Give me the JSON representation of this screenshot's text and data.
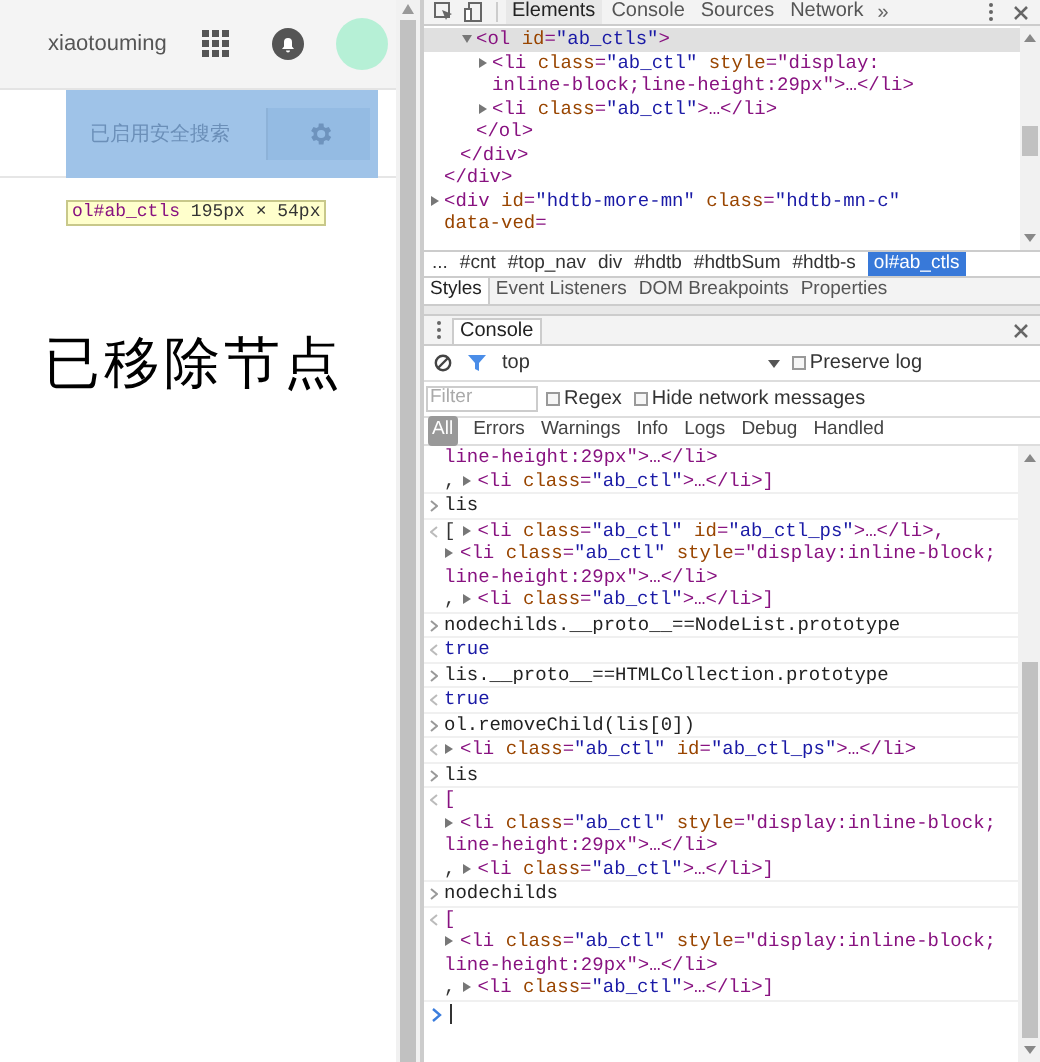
{
  "page": {
    "username": "xiaotouming",
    "safe_search": {
      "label": "已启用安全搜索"
    },
    "tooltip": "ol#ab_ctls 195px × 54px",
    "handwritten_note": "已移除节点"
  },
  "devtools": {
    "tabs": [
      {
        "label": "Elements",
        "selected": true
      },
      {
        "label": "Console",
        "selected": false
      },
      {
        "label": "Sources",
        "selected": false
      },
      {
        "label": "Network",
        "selected": false
      }
    ],
    "more_tabs": "»",
    "elements_tree": [
      {
        "closing": "</div>",
        "children": [
          {
            "closing": "</div>",
            "children": [
              {
                "lines": [
                  "<ol id=\"ab_ctls\">"
                ],
                "expanded": true,
                "selected": true,
                "closing": "</ol>",
                "children": [
                  {
                    "lines": [
                      "<li class=\"ab_ctl\" style=\"display:",
                      "inline-block;line-height:29px\">…</li>"
                    ],
                    "expanded": false,
                    "selected": false
                  },
                  {
                    "lines": [
                      "<li class=\"ab_ctl\">…</li>"
                    ],
                    "expanded": false,
                    "selected": false
                  }
                ]
              }
            ]
          }
        ]
      },
      {
        "lines": [
          "<div id=\"hdtb-more-mn\" class=\"hdtb-mn-c\"",
          "data-ved="
        ],
        "expanded": false,
        "selected": false
      }
    ],
    "breadcrumbs": [
      {
        "label": "...",
        "selected": false
      },
      {
        "label": "#cnt",
        "selected": false
      },
      {
        "label": "#top_nav",
        "selected": false
      },
      {
        "label": "div",
        "selected": false
      },
      {
        "label": "#hdtb",
        "selected": false
      },
      {
        "label": "#hdtbSum",
        "selected": false
      },
      {
        "label": "#hdtb-s",
        "selected": false
      },
      {
        "label": "ol#ab_ctls",
        "selected": true
      }
    ],
    "sidebar_tabs": [
      {
        "label": "Styles",
        "selected": true
      },
      {
        "label": "Event Listeners",
        "selected": false
      },
      {
        "label": "DOM Breakpoints",
        "selected": false
      },
      {
        "label": "Properties",
        "selected": false
      }
    ],
    "drawer_tabs": [
      {
        "label": "Console",
        "selected": true
      }
    ],
    "console": {
      "context": "top",
      "preserve_log": {
        "label": "Preserve log",
        "checked": false
      },
      "filter": {
        "placeholder": "Filter"
      },
      "options": [
        {
          "label": "Regex",
          "checked": false
        },
        {
          "label": "Hide network messages",
          "checked": false
        }
      ],
      "levels": [
        {
          "label": "All",
          "selected": true
        },
        {
          "label": "Errors",
          "selected": false
        },
        {
          "label": "Warnings",
          "selected": false
        },
        {
          "label": "Info",
          "selected": false
        },
        {
          "label": "Logs",
          "selected": false
        },
        {
          "label": "Debug",
          "selected": false
        },
        {
          "label": "Handled",
          "selected": false
        }
      ],
      "entries": [
        {
          "kind": "continued",
          "lines": [
            {
              "text": "line-height:29px\">…</li>"
            },
            {
              "lead": ",",
              "expandable": true,
              "text": "<li class=\"ab_ctl\">…</li>]"
            }
          ]
        },
        {
          "kind": "input",
          "lines": [
            {
              "text": "lis"
            }
          ]
        },
        {
          "kind": "output",
          "lines": [
            {
              "lead": "[",
              "expandable": true,
              "text": "<li class=\"ab_ctl\" id=\"ab_ctl_ps\">…</li>,"
            },
            {
              "expandable": true,
              "text": "<li class=\"ab_ctl\" style=\"display:inline-block;"
            },
            {
              "text": "line-height:29px\">…</li>"
            },
            {
              "lead": ",",
              "expandable": true,
              "text": "<li class=\"ab_ctl\">…</li>]"
            }
          ]
        },
        {
          "kind": "input",
          "lines": [
            {
              "text": "nodechilds.__proto__==NodeList.prototype"
            }
          ]
        },
        {
          "kind": "value",
          "lines": [
            {
              "text": "true"
            }
          ]
        },
        {
          "kind": "input",
          "lines": [
            {
              "text": "lis.__proto__==HTMLCollection.prototype"
            }
          ]
        },
        {
          "kind": "value",
          "lines": [
            {
              "text": "true"
            }
          ]
        },
        {
          "kind": "input",
          "lines": [
            {
              "text": "ol.removeChild(lis[0])"
            }
          ]
        },
        {
          "kind": "output",
          "lines": [
            {
              "expandable": true,
              "text": "<li class=\"ab_ctl\" id=\"ab_ctl_ps\">…</li>"
            }
          ]
        },
        {
          "kind": "input",
          "lines": [
            {
              "text": "lis"
            }
          ]
        },
        {
          "kind": "output",
          "lines": [
            {
              "text": "["
            },
            {
              "expandable": true,
              "text": "<li class=\"ab_ctl\" style=\"display:inline-block;"
            },
            {
              "text": "line-height:29px\">…</li>"
            },
            {
              "lead": ",",
              "expandable": true,
              "text": "<li class=\"ab_ctl\">…</li>]"
            }
          ]
        },
        {
          "kind": "input",
          "lines": [
            {
              "text": "nodechilds"
            }
          ]
        },
        {
          "kind": "output",
          "lines": [
            {
              "text": "["
            },
            {
              "expandable": true,
              "text": "<li class=\"ab_ctl\" style=\"display:inline-block;"
            },
            {
              "text": "line-height:29px\">…</li>"
            },
            {
              "lead": ",",
              "expandable": true,
              "text": "<li class=\"ab_ctl\">…</li>]"
            }
          ]
        }
      ]
    }
  }
}
